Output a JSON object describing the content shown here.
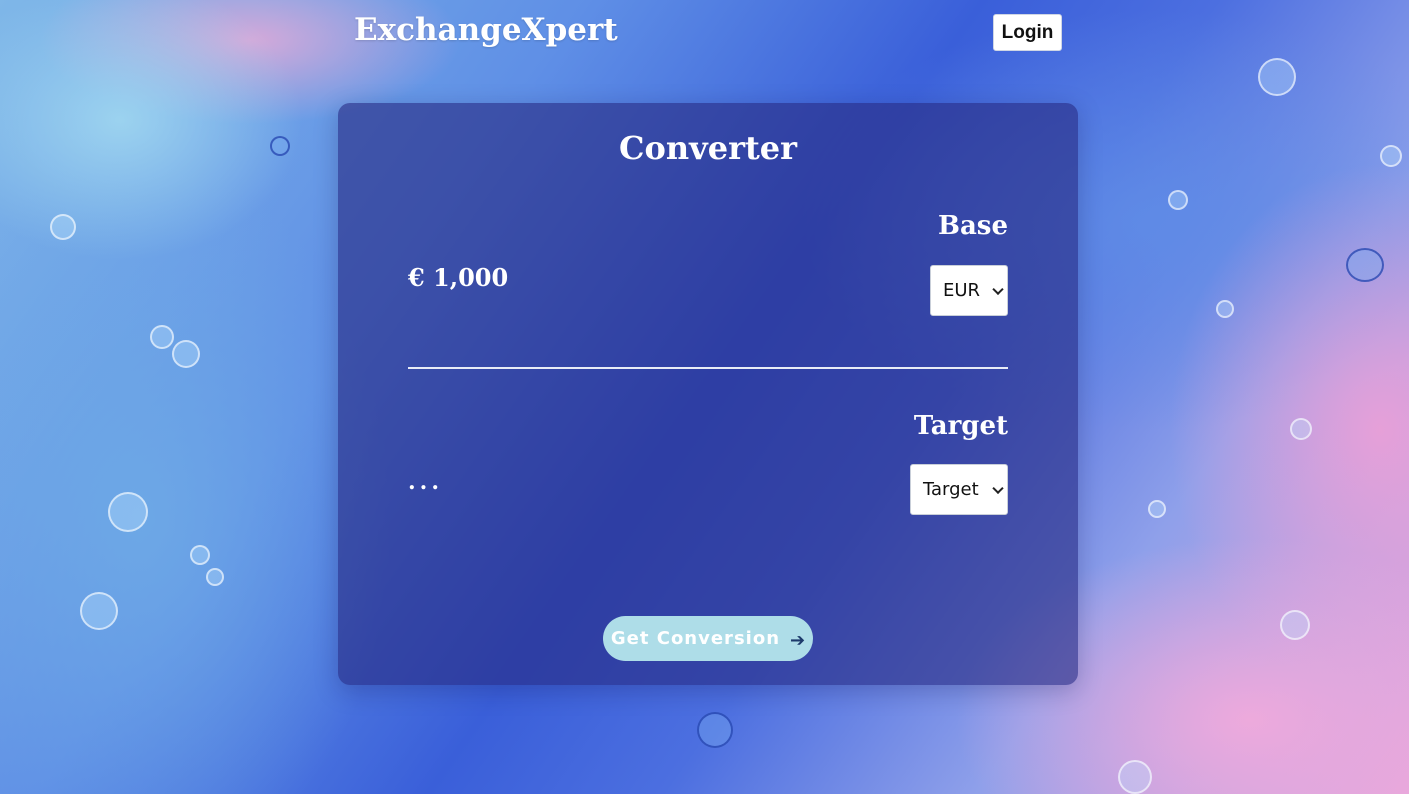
{
  "header": {
    "brand": "ExchangeXpert",
    "login_label": "Login"
  },
  "converter": {
    "title": "Converter",
    "base_label": "Base",
    "target_label": "Target",
    "amount_display": "€ 1,000",
    "result_display": "...",
    "base_select_value": "EUR",
    "target_select_value": "Target",
    "button_label": "Get Conversion",
    "button_icon": "arrow-right-icon"
  },
  "colors": {
    "card_background": "#262a82",
    "button_background": "#aedde8",
    "text": "#ffffff"
  }
}
